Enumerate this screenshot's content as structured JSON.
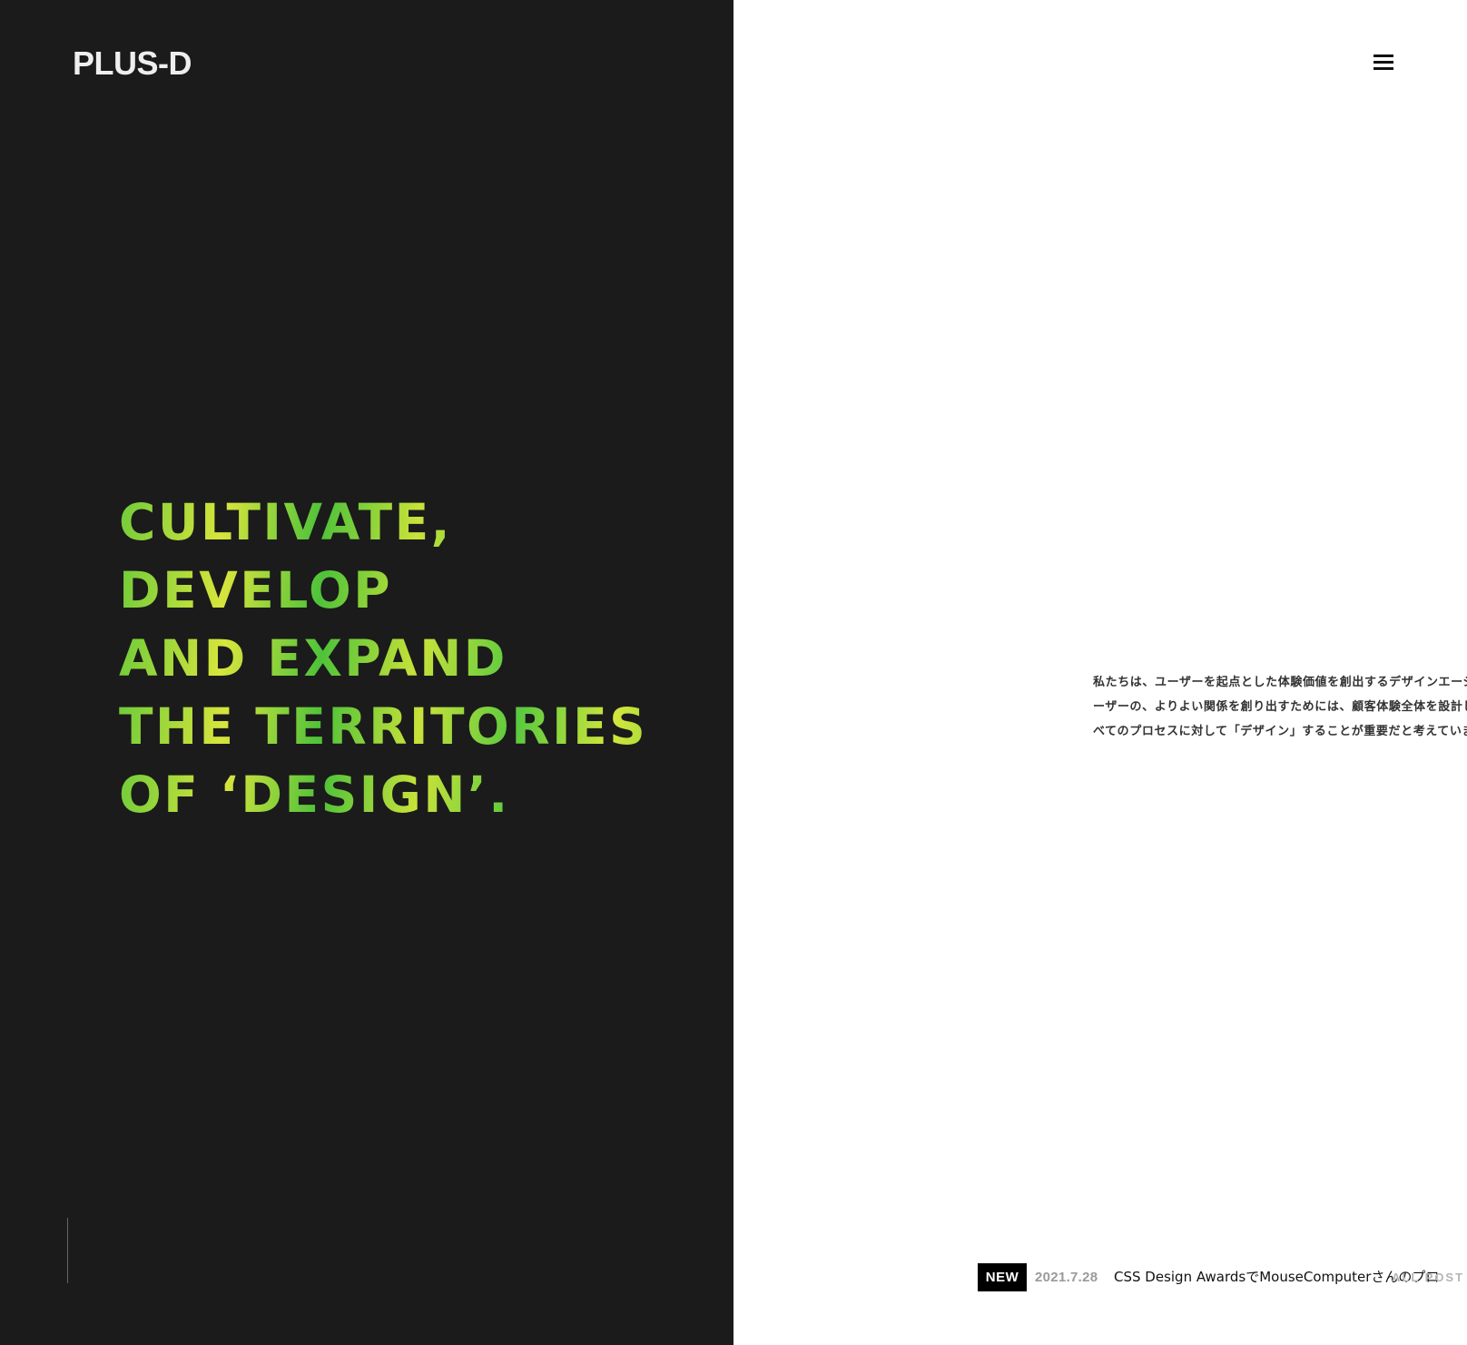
{
  "header": {
    "logo": "PLUS-D",
    "menu_icon": "hamburger-menu-icon"
  },
  "hero": {
    "lines": [
      "CULTIVATE,",
      "DEVELOP",
      "AND EXPAND",
      "THE TERRITORIES",
      "OF ‘DESIGN’."
    ],
    "colors": {
      "left_panel": "#1b1b1b",
      "gradient_green": "#4fc23a",
      "gradient_lime": "#d7e53c"
    }
  },
  "intro": {
    "lines": [
      "私たちは、ユーザーを起点とした体験価値を創出するデザインエージ",
      "ーザーの、よりよい関係を創り出すためには、顧客体験全体を設計し",
      "べてのプロセスに対して「デザイン」することが重要だと考えていま"
    ]
  },
  "news": {
    "badge": "NEW",
    "date": "2021.7.28",
    "title": "CSS Design AwardsでMouseComputerさんのプロ",
    "more": "ALL POST"
  }
}
